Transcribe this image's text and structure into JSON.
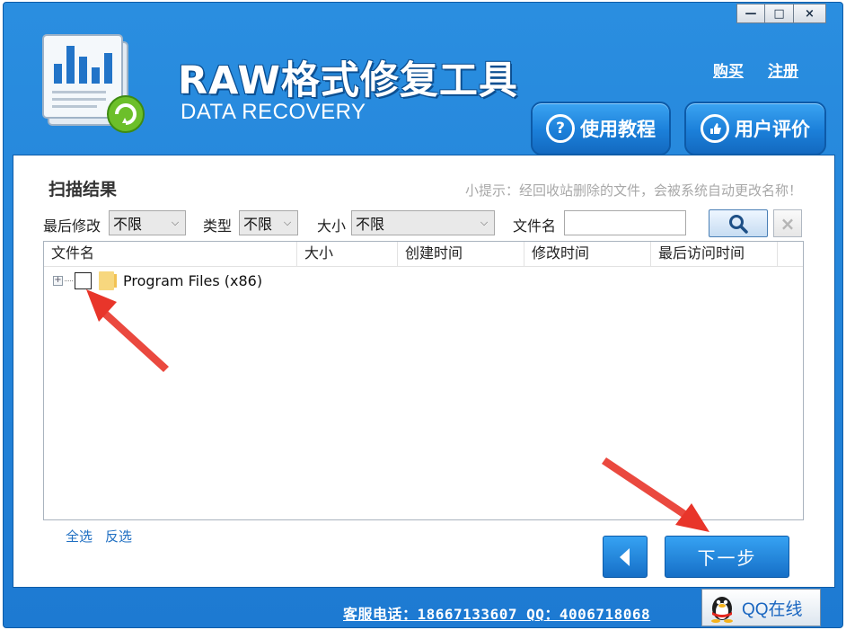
{
  "window": {
    "controls": {
      "minimize": "—",
      "maximize": "□",
      "close": "×"
    }
  },
  "header": {
    "title": "RAW格式修复工具",
    "subtitle": "DATA RECOVERY",
    "buy_link": "购买",
    "register_link": "注册",
    "tutorial_button": "使用教程",
    "tutorial_icon": "?",
    "review_button": "用户评价"
  },
  "panel": {
    "title": "扫描结果",
    "tip": "小提示：经回收站删除的文件，会被系统自动更改名称！",
    "filters": {
      "last_modified_label": "最后修改",
      "last_modified_value": "不限",
      "type_label": "类型",
      "type_value": "不限",
      "size_label": "大小",
      "size_value": "不限",
      "filename_label": "文件名",
      "filename_value": ""
    },
    "columns": [
      "文件名",
      "大小",
      "创建时间",
      "修改时间",
      "最后访问时间"
    ],
    "rows": [
      {
        "name": "Program Files (x86)",
        "checked": false,
        "expand": "+"
      }
    ],
    "select_all": "全选",
    "invert_select": "反选",
    "next_button": "下一步"
  },
  "footer": {
    "contact": "客服电话：18667133607 QQ：4006718068",
    "qq_button": "QQ在线"
  },
  "colors": {
    "frame": "#1d7ad2",
    "accent_button": "#1b7fd9",
    "link": "#1f6fc2",
    "annotation_arrow": "#e8352a"
  }
}
